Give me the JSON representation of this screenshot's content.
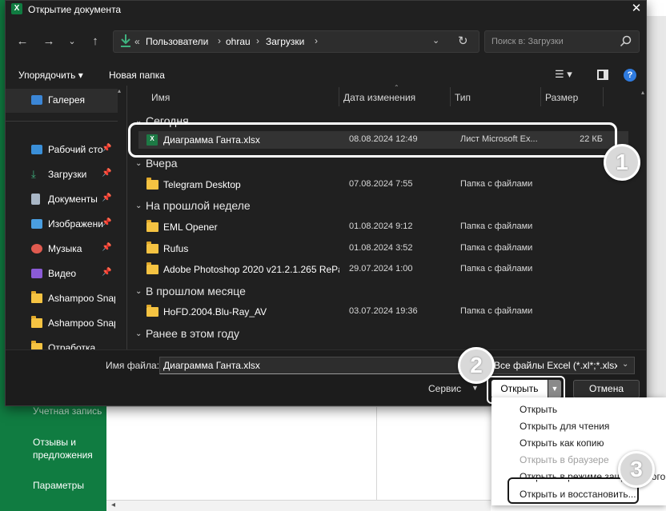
{
  "window": {
    "title": "Открытие документа",
    "app_icon_label": "X"
  },
  "background_app": {
    "sidebar": {
      "account": "Учетная запись",
      "feedback": "Отзывы и предложения",
      "params": "Параметры"
    }
  },
  "address": {
    "prefix": "«",
    "crumbs": [
      "Пользователи",
      "ohrau",
      "Загрузки"
    ],
    "separator": "›"
  },
  "search": {
    "placeholder": "Поиск в: Загрузки"
  },
  "toolbar": {
    "organize": "Упорядочить ▾",
    "new_folder": "Новая папка"
  },
  "nav_pane": {
    "gallery": "Галерея",
    "items": [
      {
        "label": "Рабочий сто",
        "pinned": true
      },
      {
        "label": "Загрузки",
        "pinned": true
      },
      {
        "label": "Документы",
        "pinned": true
      },
      {
        "label": "Изображени",
        "pinned": true
      },
      {
        "label": "Музыка",
        "pinned": true
      },
      {
        "label": "Видео",
        "pinned": true
      },
      {
        "label": "Ashampoo Snap",
        "pinned": false
      },
      {
        "label": "Ashampoo Snap",
        "pinned": false
      },
      {
        "label": "Отработка",
        "pinned": false
      }
    ]
  },
  "columns": {
    "name": "Имя",
    "date": "Дата изменения",
    "type": "Тип",
    "size": "Размер"
  },
  "groups": [
    {
      "label": "Сегодня",
      "files": [
        {
          "name": "Диаграмма Ганта.xlsx",
          "date": "08.08.2024 12:49",
          "type": "Лист Microsoft Ex...",
          "size": "22 КБ",
          "kind": "xlsx",
          "selected": true
        }
      ]
    },
    {
      "label": "Вчера",
      "files": [
        {
          "name": "Telegram Desktop",
          "date": "07.08.2024 7:55",
          "type": "Папка с файлами",
          "size": "",
          "kind": "folder",
          "selected": false
        }
      ]
    },
    {
      "label": "На прошлой неделе",
      "files": [
        {
          "name": "EML Opener",
          "date": "01.08.2024 9:12",
          "type": "Папка с файлами",
          "size": "",
          "kind": "folder",
          "selected": false
        },
        {
          "name": "Rufus",
          "date": "01.08.2024 3:52",
          "type": "Папка с файлами",
          "size": "",
          "kind": "folder",
          "selected": false
        },
        {
          "name": "Adobe Photoshop 2020 v21.2.1.265 RePa...",
          "date": "29.07.2024 1:00",
          "type": "Папка с файлами",
          "size": "",
          "kind": "folder",
          "selected": false
        }
      ]
    },
    {
      "label": "В прошлом месяце",
      "files": [
        {
          "name": "HoFD.2004.Blu-Ray_AV",
          "date": "03.07.2024 19:36",
          "type": "Папка с файлами",
          "size": "",
          "kind": "folder",
          "selected": false
        }
      ]
    },
    {
      "label": "Ранее в этом году",
      "files": []
    }
  ],
  "bottom": {
    "filename_label": "Имя файла:",
    "filename_value": "Диаграмма Ганта.xlsx",
    "filter_value": "Все файлы Excel (*.xl*;*.xlsx;*.x",
    "service": "Сервис",
    "open": "Открыть",
    "cancel": "Отмена"
  },
  "open_menu": {
    "items": [
      {
        "label": "Открыть",
        "disabled": false
      },
      {
        "label": "Открыть для чтения",
        "disabled": false
      },
      {
        "label": "Открыть как копию",
        "disabled": false
      },
      {
        "label": "Открыть в браузере",
        "disabled": true
      },
      {
        "label": "Открыть в режиме защищенного п",
        "disabled": false
      },
      {
        "label": "Открыть и восстановить...",
        "disabled": false
      }
    ]
  },
  "callouts": [
    "1",
    "2",
    "3"
  ],
  "colors": {
    "excel_green": "#107c41",
    "dialog_bg": "#202020",
    "folder": "#f5c342",
    "help_blue": "#2f7bdf"
  }
}
